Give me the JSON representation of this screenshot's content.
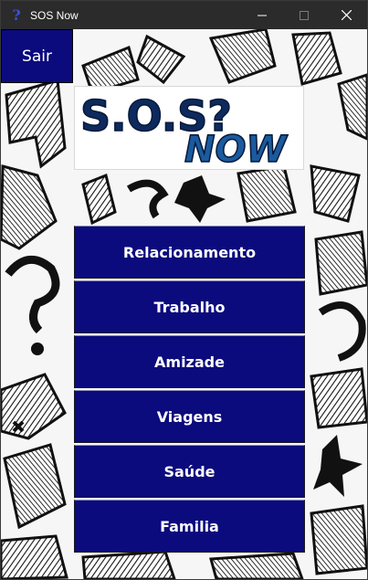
{
  "window": {
    "title": "SOS Now",
    "icon": "question-mark-icon",
    "controls": [
      "minimize-icon",
      "maximize-icon",
      "close-icon"
    ]
  },
  "exit_button": {
    "label": "Sair"
  },
  "logo": {
    "line1": "S.O.S?",
    "line2": "NOW"
  },
  "menu": {
    "items": [
      {
        "label": "Relacionamento"
      },
      {
        "label": "Trabalho"
      },
      {
        "label": "Amizade"
      },
      {
        "label": "Viagens"
      },
      {
        "label": "Saúde"
      },
      {
        "label": "Familia"
      }
    ]
  },
  "colors": {
    "button_bg": "#0b0b7d",
    "logo_dark": "#0d2a5e",
    "logo_light": "#1a5a9e",
    "titlebar": "#2b2b2b"
  }
}
